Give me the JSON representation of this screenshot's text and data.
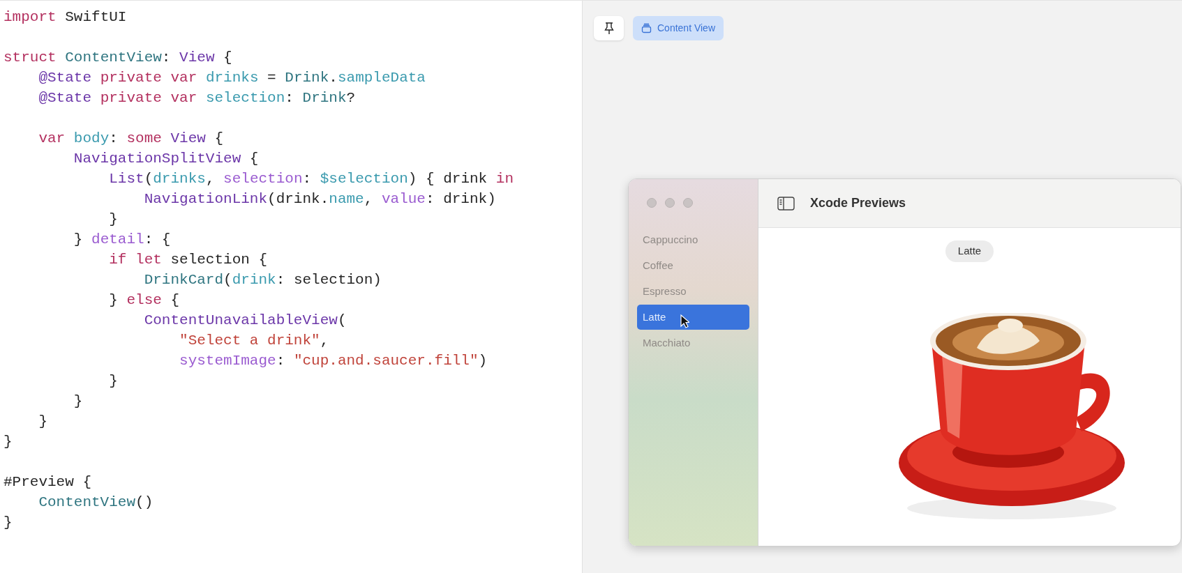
{
  "editor": {
    "lines": [
      {
        "kind": "code",
        "tokens": [
          {
            "text": "import",
            "kind": "keyword"
          },
          {
            "text": " SwiftUI",
            "kind": "plain"
          }
        ]
      },
      {
        "kind": "blank"
      },
      {
        "kind": "code",
        "tokens": [
          {
            "text": "struct",
            "kind": "keyword"
          },
          {
            "text": " ContentView",
            "kind": "decl"
          },
          {
            "text": ": ",
            "kind": "plain"
          },
          {
            "text": "View",
            "kind": "type"
          },
          {
            "text": " {",
            "kind": "plain"
          }
        ]
      },
      {
        "kind": "code",
        "tokens": [
          {
            "text": "    @State",
            "kind": "type"
          },
          {
            "text": " private",
            "kind": "keyword"
          },
          {
            "text": " var",
            "kind": "keyword"
          },
          {
            "text": " drinks",
            "kind": "ident"
          },
          {
            "text": " = ",
            "kind": "plain"
          },
          {
            "text": "Drink",
            "kind": "decl"
          },
          {
            "text": ".",
            "kind": "plain"
          },
          {
            "text": "sampleData",
            "kind": "ident"
          }
        ]
      },
      {
        "kind": "code",
        "tokens": [
          {
            "text": "    @State",
            "kind": "type"
          },
          {
            "text": " private",
            "kind": "keyword"
          },
          {
            "text": " var",
            "kind": "keyword"
          },
          {
            "text": " selection",
            "kind": "ident"
          },
          {
            "text": ": ",
            "kind": "plain"
          },
          {
            "text": "Drink",
            "kind": "decl"
          },
          {
            "text": "?",
            "kind": "plain"
          }
        ]
      },
      {
        "kind": "blank"
      },
      {
        "kind": "code",
        "tokens": [
          {
            "text": "    var",
            "kind": "keyword"
          },
          {
            "text": " body",
            "kind": "ident"
          },
          {
            "text": ": ",
            "kind": "plain"
          },
          {
            "text": "some",
            "kind": "keyword"
          },
          {
            "text": " View",
            "kind": "type"
          },
          {
            "text": " {",
            "kind": "plain"
          }
        ]
      },
      {
        "kind": "code",
        "tokens": [
          {
            "text": "        NavigationSplitView",
            "kind": "type"
          },
          {
            "text": " {",
            "kind": "plain"
          }
        ]
      },
      {
        "kind": "code",
        "tokens": [
          {
            "text": "            List",
            "kind": "type"
          },
          {
            "text": "(",
            "kind": "plain"
          },
          {
            "text": "drinks",
            "kind": "ident"
          },
          {
            "text": ", ",
            "kind": "plain"
          },
          {
            "text": "selection",
            "kind": "label"
          },
          {
            "text": ": ",
            "kind": "plain"
          },
          {
            "text": "$selection",
            "kind": "ident"
          },
          {
            "text": ") { drink ",
            "kind": "plain"
          },
          {
            "text": "in",
            "kind": "keyword"
          }
        ]
      },
      {
        "kind": "code",
        "tokens": [
          {
            "text": "                NavigationLink",
            "kind": "type"
          },
          {
            "text": "(drink.",
            "kind": "plain"
          },
          {
            "text": "name",
            "kind": "ident"
          },
          {
            "text": ", ",
            "kind": "plain"
          },
          {
            "text": "value",
            "kind": "label"
          },
          {
            "text": ": drink)",
            "kind": "plain"
          }
        ]
      },
      {
        "kind": "code",
        "tokens": [
          {
            "text": "            }",
            "kind": "plain"
          }
        ]
      },
      {
        "kind": "code",
        "tokens": [
          {
            "text": "        } ",
            "kind": "plain"
          },
          {
            "text": "detail",
            "kind": "label"
          },
          {
            "text": ": {",
            "kind": "plain"
          }
        ]
      },
      {
        "kind": "code",
        "tokens": [
          {
            "text": "            if",
            "kind": "keyword"
          },
          {
            "text": " let",
            "kind": "keyword"
          },
          {
            "text": " selection {",
            "kind": "plain"
          }
        ]
      },
      {
        "kind": "code",
        "tokens": [
          {
            "text": "                DrinkCard",
            "kind": "decl"
          },
          {
            "text": "(",
            "kind": "plain"
          },
          {
            "text": "drink",
            "kind": "ident"
          },
          {
            "text": ": selection)",
            "kind": "plain"
          }
        ]
      },
      {
        "kind": "code",
        "tokens": [
          {
            "text": "            } ",
            "kind": "plain"
          },
          {
            "text": "else",
            "kind": "keyword"
          },
          {
            "text": " {",
            "kind": "plain"
          }
        ]
      },
      {
        "kind": "code",
        "tokens": [
          {
            "text": "                ContentUnavailableView",
            "kind": "type"
          },
          {
            "text": "(",
            "kind": "plain"
          }
        ]
      },
      {
        "kind": "code",
        "tokens": [
          {
            "text": "                    \"Select a drink\"",
            "kind": "string"
          },
          {
            "text": ",",
            "kind": "plain"
          }
        ]
      },
      {
        "kind": "code",
        "tokens": [
          {
            "text": "                    systemImage",
            "kind": "label"
          },
          {
            "text": ": ",
            "kind": "plain"
          },
          {
            "text": "\"cup.and.saucer.fill\"",
            "kind": "string"
          },
          {
            "text": ")",
            "kind": "plain"
          }
        ]
      },
      {
        "kind": "code",
        "tokens": [
          {
            "text": "            }",
            "kind": "plain"
          }
        ]
      },
      {
        "kind": "code",
        "tokens": [
          {
            "text": "        }",
            "kind": "plain"
          }
        ]
      },
      {
        "kind": "code",
        "tokens": [
          {
            "text": "    }",
            "kind": "plain"
          }
        ]
      },
      {
        "kind": "code",
        "tokens": [
          {
            "text": "}",
            "kind": "plain"
          }
        ]
      },
      {
        "kind": "blank"
      },
      {
        "kind": "code",
        "tokens": [
          {
            "text": "#Preview {",
            "kind": "plain"
          }
        ]
      },
      {
        "kind": "code",
        "tokens": [
          {
            "text": "    ContentView",
            "kind": "decl"
          },
          {
            "text": "()",
            "kind": "plain"
          }
        ]
      },
      {
        "kind": "code",
        "tokens": [
          {
            "text": "}",
            "kind": "plain"
          }
        ]
      }
    ]
  },
  "preview_toolbar": {
    "pin": {
      "selected": false
    },
    "tab": {
      "label": "Content View",
      "selected": true
    }
  },
  "preview_window": {
    "title": "Xcode Previews",
    "sidebar": [
      {
        "label": "Cappuccino",
        "selected": false
      },
      {
        "label": "Coffee",
        "selected": false
      },
      {
        "label": "Espresso",
        "selected": false
      },
      {
        "label": "Latte",
        "selected": true
      },
      {
        "label": "Macchiato",
        "selected": false
      }
    ],
    "detail": {
      "title": "Latte"
    }
  }
}
